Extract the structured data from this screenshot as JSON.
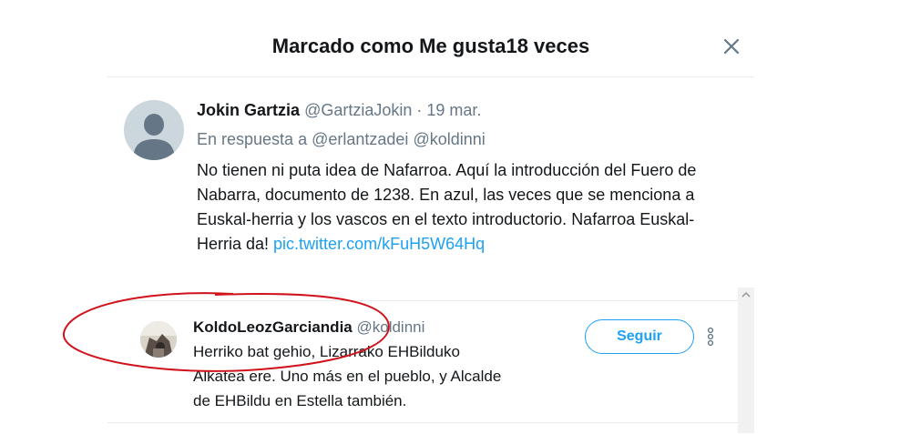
{
  "modal": {
    "title": "Marcado como Me gusta18 veces"
  },
  "tweet": {
    "name": "Jokin Gartzia",
    "handle": "@GartziaJokin",
    "separator": "·",
    "date": "19 mar.",
    "reply_prefix": "En respuesta a",
    "reply_mentions": [
      "@erlantzadei",
      "@koldinni"
    ],
    "text": "No tienen ni puta idea de Nafarroa. Aquí la introducción  del Fuero de Nabarra, documento de 1238. En  azul, las veces que se menciona a Euskal-herria y los vascos en el texto introductorio. Nafarroa Euskal-Herria da!",
    "link": "pic.twitter.com/kFuH5W64Hq"
  },
  "users": [
    {
      "name": "KoldoLeozGarciandia",
      "handle": "@koldinni",
      "bio": "Herriko bat gehio, Lizarrako EHBilduko Alkatea ere. Uno más en el pueblo, y Alcalde de EHBildu en Estella también.",
      "follow_label": "Seguir"
    }
  ],
  "colors": {
    "accent": "#1da1f2",
    "text_primary": "#14171a",
    "text_secondary": "#657786",
    "divider": "#e6ecf0",
    "annotation": "#d0121b"
  },
  "icons": {
    "close": "close-icon",
    "more": "more-vertical-icon",
    "scroll_up": "scroll-up-arrow-icon"
  }
}
